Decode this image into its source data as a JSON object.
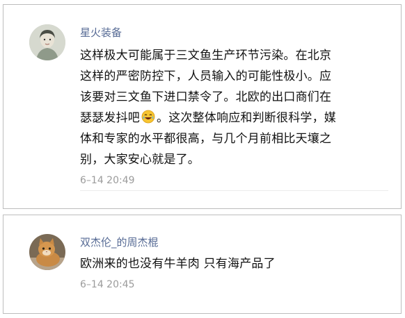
{
  "comments": [
    {
      "username": "星火装备",
      "text_before_emoji": "这样极大可能属于三文鱼生产环节污染。在北京\n这样的严密防控下，人员输入的可能性极小。应\n该要对三文鱼下进口禁令了。北欧的出口商们在\n瑟瑟发抖吧",
      "emoji": "laugh-crying-icon",
      "text_after_emoji": "。这次整体响应和判断很科学，媒\n体和专家的水平都很高，与几个月前相比天壤之\n别，大家安心就是了。",
      "timestamp": "6–14 20:49"
    },
    {
      "username": "双杰伦_的周杰棍",
      "text": "欧洲来的也没有牛羊肉 只有海产品了",
      "timestamp": "6–14 20:45"
    }
  ],
  "colors": {
    "username": "#576b95",
    "text": "#111111",
    "timestamp": "#9b9b9b",
    "border": "#bdbdbd"
  }
}
